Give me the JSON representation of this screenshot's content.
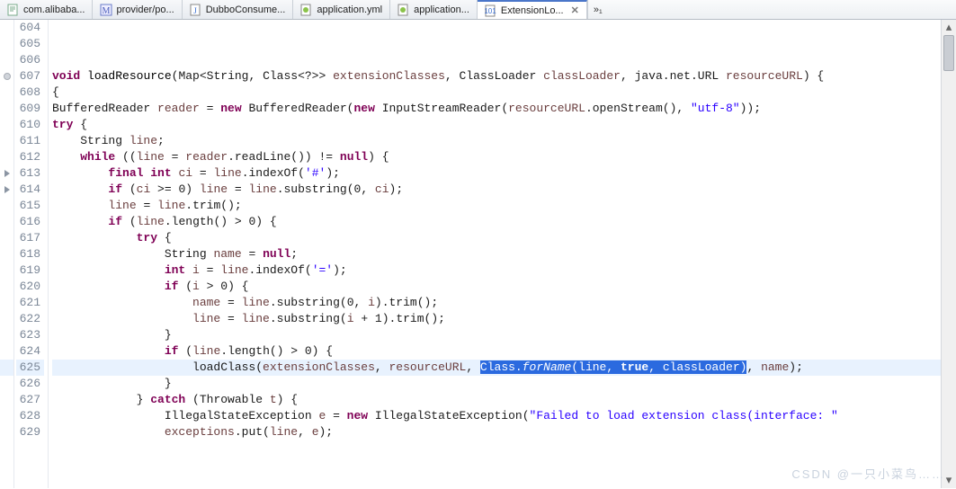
{
  "tabs": [
    {
      "label": "com.alibaba...",
      "icon": "text",
      "active": false
    },
    {
      "label": "provider/po...",
      "icon": "m",
      "active": false
    },
    {
      "label": "DubboConsume...",
      "icon": "java",
      "active": false
    },
    {
      "label": "application.yml",
      "icon": "yml",
      "active": false
    },
    {
      "label": "application...",
      "icon": "yml",
      "active": false
    },
    {
      "label": "ExtensionLo...",
      "icon": "class",
      "active": true
    }
  ],
  "more_tabs_label": "»₁",
  "first_line_number": 604,
  "highlighted_line": 625,
  "markers": {
    "607": "circle",
    "613": "arrow",
    "614": "arrow"
  },
  "code_lines": [
    {
      "n": 604,
      "t": [
        [
          "",
          ""
        ]
      ]
    },
    {
      "n": 605,
      "t": [
        [
          "",
          ""
        ]
      ]
    },
    {
      "n": 606,
      "t": [
        [
          "",
          ""
        ]
      ]
    },
    {
      "n": 607,
      "t": [
        [
          "kw",
          "void"
        ],
        [
          "",
          " "
        ],
        [
          "m",
          "loadResource"
        ],
        [
          "",
          "(Map<String, Class<?>> "
        ],
        [
          "var",
          "extensionClasses"
        ],
        [
          "",
          ", ClassLoader "
        ],
        [
          "var",
          "classLoader"
        ],
        [
          "",
          ", java.net.URL "
        ],
        [
          "var",
          "resourceURL"
        ],
        [
          "",
          ") {"
        ]
      ]
    },
    {
      "n": 608,
      "t": [
        [
          "",
          "{"
        ]
      ]
    },
    {
      "n": 609,
      "t": [
        [
          "",
          "BufferedReader "
        ],
        [
          "var",
          "reader"
        ],
        [
          "",
          " = "
        ],
        [
          "kw",
          "new"
        ],
        [
          "",
          " BufferedReader("
        ],
        [
          "kw",
          "new"
        ],
        [
          "",
          " InputStreamReader("
        ],
        [
          "var",
          "resourceURL"
        ],
        [
          "",
          ".openStream(), "
        ],
        [
          "str",
          "\"utf-8\""
        ],
        [
          "",
          "));"
        ]
      ]
    },
    {
      "n": 610,
      "t": [
        [
          "kw",
          "try"
        ],
        [
          "",
          " {"
        ]
      ]
    },
    {
      "n": 611,
      "t": [
        [
          "",
          "    String "
        ],
        [
          "var",
          "line"
        ],
        [
          "",
          ";"
        ]
      ]
    },
    {
      "n": 612,
      "t": [
        [
          "",
          "    "
        ],
        [
          "kw",
          "while"
        ],
        [
          "",
          " (("
        ],
        [
          "var",
          "line"
        ],
        [
          "",
          " = "
        ],
        [
          "var",
          "reader"
        ],
        [
          "",
          ".readLine()) != "
        ],
        [
          "kw",
          "null"
        ],
        [
          "",
          ") {"
        ]
      ]
    },
    {
      "n": 613,
      "t": [
        [
          "",
          "        "
        ],
        [
          "kw",
          "final int"
        ],
        [
          "",
          " "
        ],
        [
          "var",
          "ci"
        ],
        [
          "",
          " = "
        ],
        [
          "var",
          "line"
        ],
        [
          "",
          ".indexOf("
        ],
        [
          "str",
          "'#'"
        ],
        [
          "",
          ");"
        ]
      ]
    },
    {
      "n": 614,
      "t": [
        [
          "",
          "        "
        ],
        [
          "kw",
          "if"
        ],
        [
          "",
          " ("
        ],
        [
          "var",
          "ci"
        ],
        [
          "",
          " >= 0) "
        ],
        [
          "var",
          "line"
        ],
        [
          "",
          " = "
        ],
        [
          "var",
          "line"
        ],
        [
          "",
          ".substring(0, "
        ],
        [
          "var",
          "ci"
        ],
        [
          "",
          ");"
        ]
      ]
    },
    {
      "n": 615,
      "t": [
        [
          "",
          "        "
        ],
        [
          "var",
          "line"
        ],
        [
          "",
          " = "
        ],
        [
          "var",
          "line"
        ],
        [
          "",
          ".trim();"
        ]
      ]
    },
    {
      "n": 616,
      "t": [
        [
          "",
          "        "
        ],
        [
          "kw",
          "if"
        ],
        [
          "",
          " ("
        ],
        [
          "var",
          "line"
        ],
        [
          "",
          ".length() > 0) {"
        ]
      ]
    },
    {
      "n": 617,
      "t": [
        [
          "",
          "            "
        ],
        [
          "kw",
          "try"
        ],
        [
          "",
          " {"
        ]
      ]
    },
    {
      "n": 618,
      "t": [
        [
          "",
          "                String "
        ],
        [
          "var",
          "name"
        ],
        [
          "",
          " = "
        ],
        [
          "kw",
          "null"
        ],
        [
          "",
          ";"
        ]
      ]
    },
    {
      "n": 619,
      "t": [
        [
          "",
          "                "
        ],
        [
          "kw",
          "int"
        ],
        [
          "",
          " "
        ],
        [
          "var",
          "i"
        ],
        [
          "",
          " = "
        ],
        [
          "var",
          "line"
        ],
        [
          "",
          ".indexOf("
        ],
        [
          "str",
          "'='"
        ],
        [
          "",
          ");"
        ]
      ]
    },
    {
      "n": 620,
      "t": [
        [
          "",
          "                "
        ],
        [
          "kw",
          "if"
        ],
        [
          "",
          " ("
        ],
        [
          "var",
          "i"
        ],
        [
          "",
          " > 0) {"
        ]
      ]
    },
    {
      "n": 621,
      "t": [
        [
          "",
          "                    "
        ],
        [
          "var",
          "name"
        ],
        [
          "",
          " = "
        ],
        [
          "var",
          "line"
        ],
        [
          "",
          ".substring(0, "
        ],
        [
          "var",
          "i"
        ],
        [
          "",
          ").trim();"
        ]
      ]
    },
    {
      "n": 622,
      "t": [
        [
          "",
          "                    "
        ],
        [
          "var",
          "line"
        ],
        [
          "",
          " = "
        ],
        [
          "var",
          "line"
        ],
        [
          "",
          ".substring("
        ],
        [
          "var",
          "i"
        ],
        [
          "",
          " + 1).trim();"
        ]
      ]
    },
    {
      "n": 623,
      "t": [
        [
          "",
          "                }"
        ]
      ]
    },
    {
      "n": 624,
      "t": [
        [
          "",
          "                "
        ],
        [
          "kw",
          "if"
        ],
        [
          "",
          " ("
        ],
        [
          "var",
          "line"
        ],
        [
          "",
          ".length() > 0) {"
        ]
      ]
    },
    {
      "n": 625,
      "t": [
        [
          "",
          "                    loadClass("
        ],
        [
          "var",
          "extensionClasses"
        ],
        [
          "",
          ", "
        ],
        [
          "var",
          "resourceURL"
        ],
        [
          "",
          ", "
        ],
        [
          "sel",
          "Class."
        ],
        [
          "sel-it",
          "forName"
        ],
        [
          "sel",
          "("
        ],
        [
          "sel",
          "line"
        ],
        [
          "sel",
          ", "
        ],
        [
          "sel-kw",
          "true"
        ],
        [
          "sel",
          ", "
        ],
        [
          "sel",
          "classLoader"
        ],
        [
          "sel",
          ")"
        ],
        [
          "",
          ", "
        ],
        [
          "var",
          "name"
        ],
        [
          "",
          ");"
        ]
      ]
    },
    {
      "n": 626,
      "t": [
        [
          "",
          "                }"
        ]
      ]
    },
    {
      "n": 627,
      "t": [
        [
          "",
          "            } "
        ],
        [
          "kw",
          "catch"
        ],
        [
          "",
          " (Throwable "
        ],
        [
          "var",
          "t"
        ],
        [
          "",
          ") {"
        ]
      ]
    },
    {
      "n": 628,
      "t": [
        [
          "",
          "                IllegalStateException "
        ],
        [
          "var",
          "e"
        ],
        [
          "",
          " = "
        ],
        [
          "kw",
          "new"
        ],
        [
          "",
          " IllegalStateException("
        ],
        [
          "str",
          "\"Failed to load extension class(interface: \""
        ]
      ]
    },
    {
      "n": 629,
      "t": [
        [
          "",
          "                "
        ],
        [
          "var",
          "exceptions"
        ],
        [
          "",
          ".put("
        ],
        [
          "var",
          "line"
        ],
        [
          "",
          ", "
        ],
        [
          "var",
          "e"
        ],
        [
          "",
          ");"
        ]
      ]
    }
  ],
  "watermark": "CSDN @一只小菜鸟……"
}
